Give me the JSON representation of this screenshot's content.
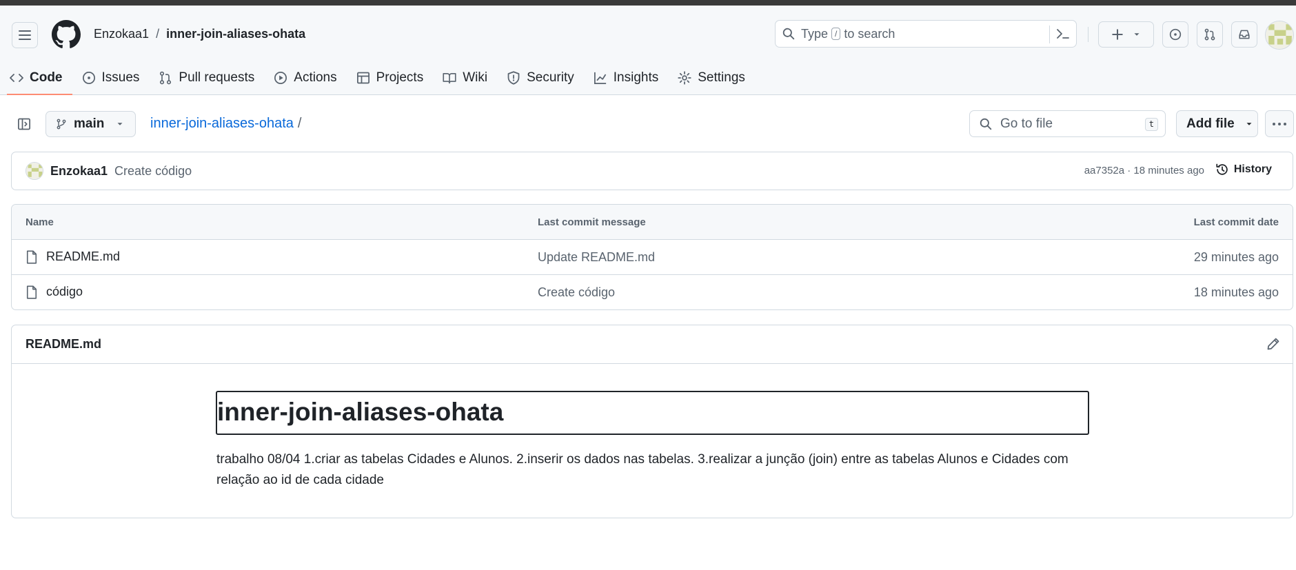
{
  "header": {
    "owner": "Enzokaa1",
    "separator": "/",
    "repo": "inner-join-aliases-ohata",
    "search": {
      "before": "Type",
      "key": "/",
      "after": "to search"
    }
  },
  "tabs": [
    {
      "label": "Code",
      "icon": "code-icon"
    },
    {
      "label": "Issues",
      "icon": "issue-opened-icon"
    },
    {
      "label": "Pull requests",
      "icon": "git-pull-request-icon"
    },
    {
      "label": "Actions",
      "icon": "play-icon"
    },
    {
      "label": "Projects",
      "icon": "table-icon"
    },
    {
      "label": "Wiki",
      "icon": "book-icon"
    },
    {
      "label": "Security",
      "icon": "shield-icon"
    },
    {
      "label": "Insights",
      "icon": "graph-icon"
    },
    {
      "label": "Settings",
      "icon": "gear-icon"
    }
  ],
  "toolbar": {
    "branch": "main",
    "path_repo": "inner-join-aliases-ohata",
    "path_sep": "/",
    "goto_placeholder": "Go to file",
    "goto_key": "t",
    "add_file": "Add file"
  },
  "commit": {
    "author": "Enzokaa1",
    "message": "Create código",
    "meta": "aa7352a · 18 minutes ago",
    "history": "History"
  },
  "files": {
    "headers": {
      "name": "Name",
      "message": "Last commit message",
      "date": "Last commit date"
    },
    "rows": [
      {
        "name": "README.md",
        "message": "Update README.md",
        "date": "29 minutes ago"
      },
      {
        "name": "código",
        "message": "Create código",
        "date": "18 minutes ago"
      }
    ]
  },
  "readme": {
    "filename": "README.md",
    "heading": "inner-join-aliases-ohata",
    "body": "trabalho 08/04 1.criar as tabelas Cidades e Alunos. 2.inserir os dados nas tabelas. 3.realizar a junção (join) entre as tabelas Alunos e Cidades com relação ao id de cada cidade"
  },
  "colors": {
    "accent": "#0969da",
    "tab_underline": "#fd8c73",
    "border": "#d1d9e0",
    "muted": "#59636e"
  }
}
